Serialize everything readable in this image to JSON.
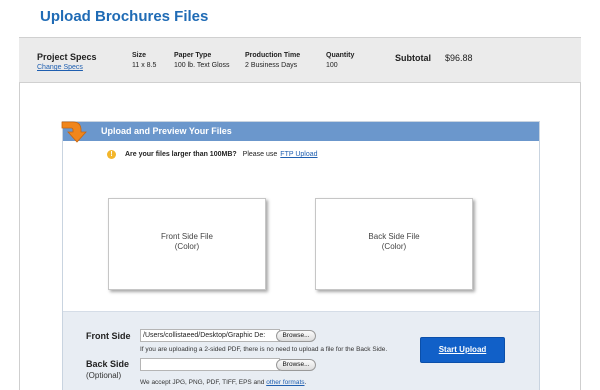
{
  "header": {
    "title": "Upload Brochures Files"
  },
  "specs": {
    "project_label": "Project Specs",
    "change_link": "Change Specs",
    "size_label": "Size",
    "size_value": "11 x 8.5",
    "paper_label": "Paper Type",
    "paper_value": "100 lb. Text Gloss",
    "production_label": "Production Time",
    "production_value": "2 Business Days",
    "quantity_label": "Quantity",
    "quantity_value": "100",
    "subtotal_label": "Subtotal",
    "subtotal_value": "$96.88"
  },
  "panel": {
    "title": "Upload and Preview Your Files",
    "notice_bold": "Are your files larger than 100MB?",
    "notice_text": "Please use",
    "notice_link": "FTP Upload",
    "front_preview_title": "Front Side File",
    "front_preview_sub": "(Color)",
    "back_preview_title": "Back Side File",
    "back_preview_sub": "(Color)"
  },
  "form": {
    "front_label": "Front Side",
    "front_value": "/Users/collistaeed/Desktop/Graphic De:",
    "browse_label": "Browse...",
    "front_hint": "If you are uploading a 2-sided PDF, there is no need to upload a file for the Back Side.",
    "back_label": "Back Side",
    "back_optional": "(Optional)",
    "back_value": "",
    "formats_text": "We accept JPG, PNG, PDF, TIFF, EPS and",
    "formats_link": "other formats",
    "formats_end": ".",
    "start_button": "Start Upload"
  },
  "colors": {
    "title_blue": "#1f6bb5",
    "panel_header": "#6b97cc",
    "start_button": "#1160c8",
    "arrow_orange": "#f0861c"
  },
  "icons": [
    "orange-arrow-icon",
    "warning-icon"
  ]
}
